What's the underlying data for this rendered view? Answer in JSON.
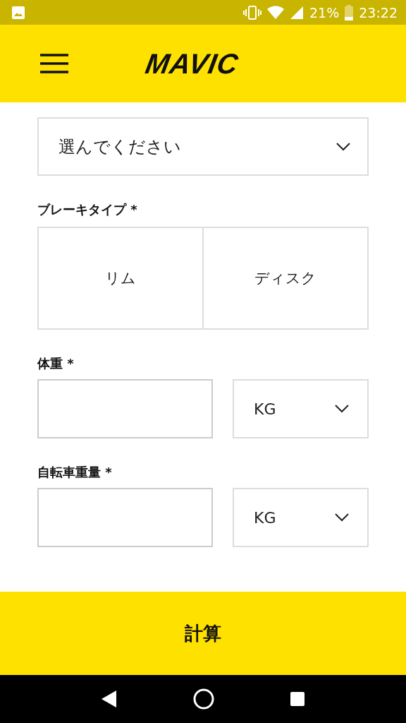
{
  "status_bar": {
    "battery": "21%",
    "time": "23:22"
  },
  "header": {
    "logo": "MAVIC"
  },
  "form": {
    "rim_width": {
      "value": "選んでください"
    },
    "brake": {
      "label": "ブレーキタイプ *",
      "options": [
        {
          "label": "リム",
          "selected": false
        },
        {
          "label": "ディスク",
          "selected": false
        }
      ]
    },
    "fields": [
      {
        "label": "体重 *",
        "unit": "KG"
      },
      {
        "label": "自転車重量 *",
        "unit": "KG"
      }
    ]
  },
  "submit": "計算"
}
